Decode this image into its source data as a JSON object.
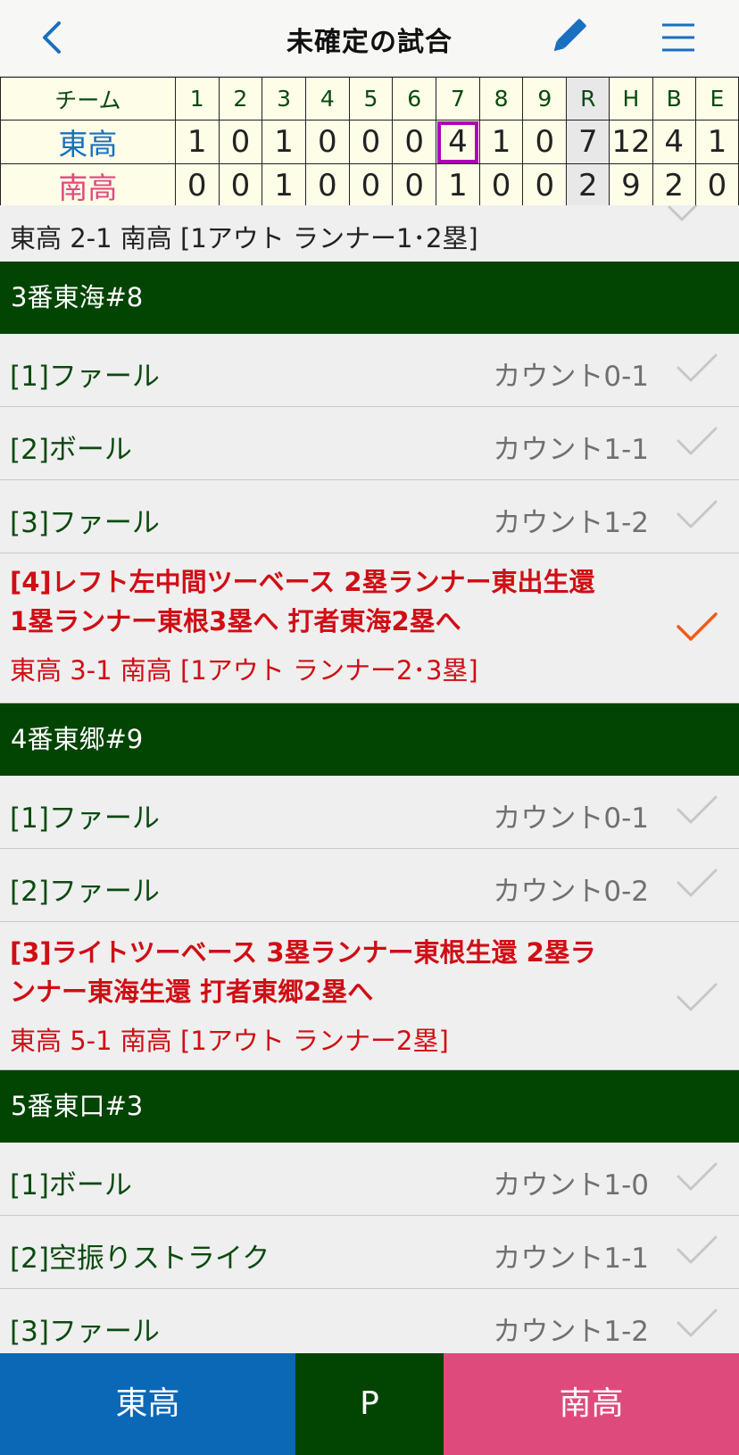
{
  "nav": {
    "title": "未確定の試合",
    "back_icon": "chevron-left-icon",
    "edit_icon": "pencil-icon",
    "menu_icon": "menu-icon"
  },
  "scoreboard": {
    "team_header": "チーム",
    "innings": [
      "1",
      "2",
      "3",
      "4",
      "5",
      "6",
      "7",
      "8",
      "9"
    ],
    "totals_headers": [
      "R",
      "H",
      "B",
      "E"
    ],
    "rows": [
      {
        "team": "東高",
        "innings": [
          "1",
          "0",
          "1",
          "0",
          "0",
          "0",
          "4",
          "1",
          "0"
        ],
        "totals": [
          "7",
          "12",
          "4",
          "1"
        ]
      },
      {
        "team": "南高",
        "innings": [
          "0",
          "0",
          "1",
          "0",
          "0",
          "0",
          "1",
          "0",
          "0"
        ],
        "totals": [
          "2",
          "9",
          "2",
          "0"
        ]
      }
    ],
    "current_inning": 7
  },
  "feed": {
    "summary": "東高 2-1 南高 [1アウト ランナー1･2塁]",
    "batters": [
      {
        "header": "3番東海#8",
        "pitches": [
          {
            "label": "[1]ファール",
            "count": "カウント0-1"
          },
          {
            "label": "[2]ボール",
            "count": "カウント1-1"
          },
          {
            "label": "[3]ファール",
            "count": "カウント1-2"
          }
        ],
        "event": {
          "line1": "[4]レフト左中間ツーベース 2塁ランナー東出生還",
          "line2": "1塁ランナー東根3塁へ 打者東海2塁へ",
          "score": "東高 3-1 南高 [1アウト ランナー2･3塁]",
          "selected": true
        }
      },
      {
        "header": "4番東郷#9",
        "pitches": [
          {
            "label": "[1]ファール",
            "count": "カウント0-1"
          },
          {
            "label": "[2]ファール",
            "count": "カウント0-2"
          }
        ],
        "event": {
          "line1": "[3]ライトツーベース 3塁ランナー東根生還 2塁ラ",
          "line2": "ンナー東海生還 打者東郷2塁へ",
          "score": "東高 5-1 南高 [1アウト ランナー2塁]",
          "selected": false
        }
      },
      {
        "header": "5番東口#3",
        "pitches": [
          {
            "label": "[1]ボール",
            "count": "カウント1-0"
          },
          {
            "label": "[2]空振りストライク",
            "count": "カウント1-1"
          },
          {
            "label": "[3]ファール",
            "count": "カウント1-2"
          }
        ]
      }
    ]
  },
  "tabs": {
    "east": "東高",
    "p": "P",
    "south": "南高"
  },
  "colors": {
    "nav_blue": "#1a6fbe",
    "dark_green": "#024402",
    "east_blue": "#0a68b6",
    "south_pink": "#df4a7d",
    "event_red": "#d00e15",
    "check_orange": "#f05a1a",
    "current_inning_outline": "#b000b8"
  }
}
